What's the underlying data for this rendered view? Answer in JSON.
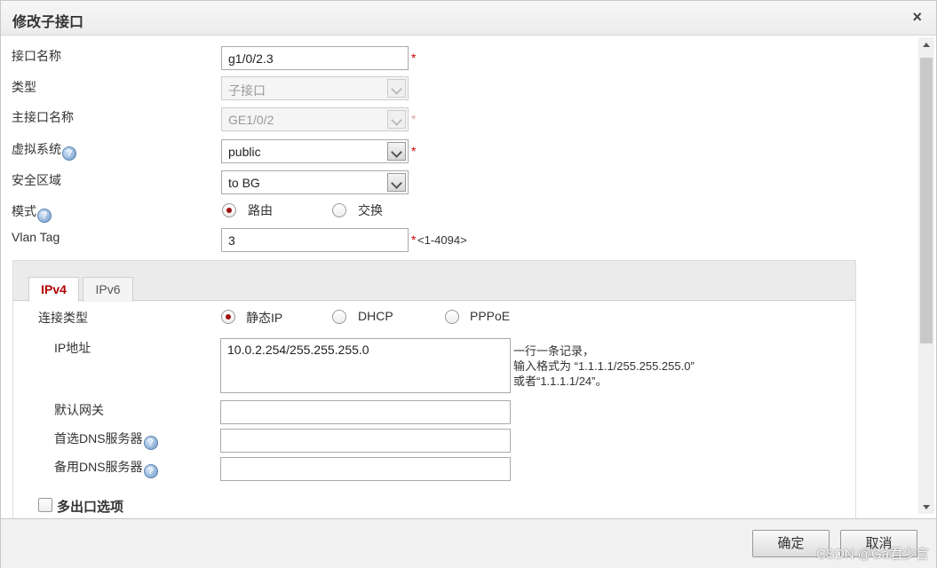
{
  "dialog": {
    "title": "修改子接口",
    "close_icon": "×"
  },
  "form": {
    "interface_name": {
      "label": "接口名称",
      "value": "g1/0/2.3",
      "required": "*"
    },
    "type": {
      "label": "类型",
      "value": "子接口"
    },
    "main_interface": {
      "label": "主接口名称",
      "value": "GE1/0/2",
      "required": "*"
    },
    "vsys": {
      "label": "虚拟系统",
      "help": "?",
      "value": "public",
      "required": "*"
    },
    "zone": {
      "label": "安全区域",
      "value": "to BG"
    },
    "mode": {
      "label": "模式",
      "help": "?",
      "options": [
        "路由",
        "交换"
      ],
      "selected": "路由"
    },
    "vlan_tag": {
      "label": "Vlan Tag",
      "value": "3",
      "required": "*",
      "hint": "<1-4094>"
    }
  },
  "tabs": [
    {
      "label": "IPv4",
      "active": true
    },
    {
      "label": "IPv6",
      "active": false
    }
  ],
  "ipv4": {
    "conn_type": {
      "label": "连接类型",
      "options": [
        "静态IP",
        "DHCP",
        "PPPoE"
      ],
      "selected": "静态IP"
    },
    "ip": {
      "label": "IP地址",
      "value": "10.0.2.254/255.255.255.0",
      "note": [
        "一行一条记录，",
        "输入格式为 “1.1.1.1/255.255.255.0”",
        "或者“1.1.1.1/24”。"
      ]
    },
    "gateway": {
      "label": "默认网关",
      "value": ""
    },
    "dns1": {
      "label": "首选DNS服务器",
      "help": "?",
      "value": ""
    },
    "dns2": {
      "label": "备用DNS服务器",
      "help": "?",
      "value": ""
    },
    "multi_exit": {
      "label": "多出口选项",
      "checked": false
    }
  },
  "footer": {
    "ok": "确定",
    "cancel": "取消"
  },
  "watermark": "CSDN @Ga君少言",
  "colors": {
    "accent": "#b00000",
    "required": "#d40000"
  }
}
